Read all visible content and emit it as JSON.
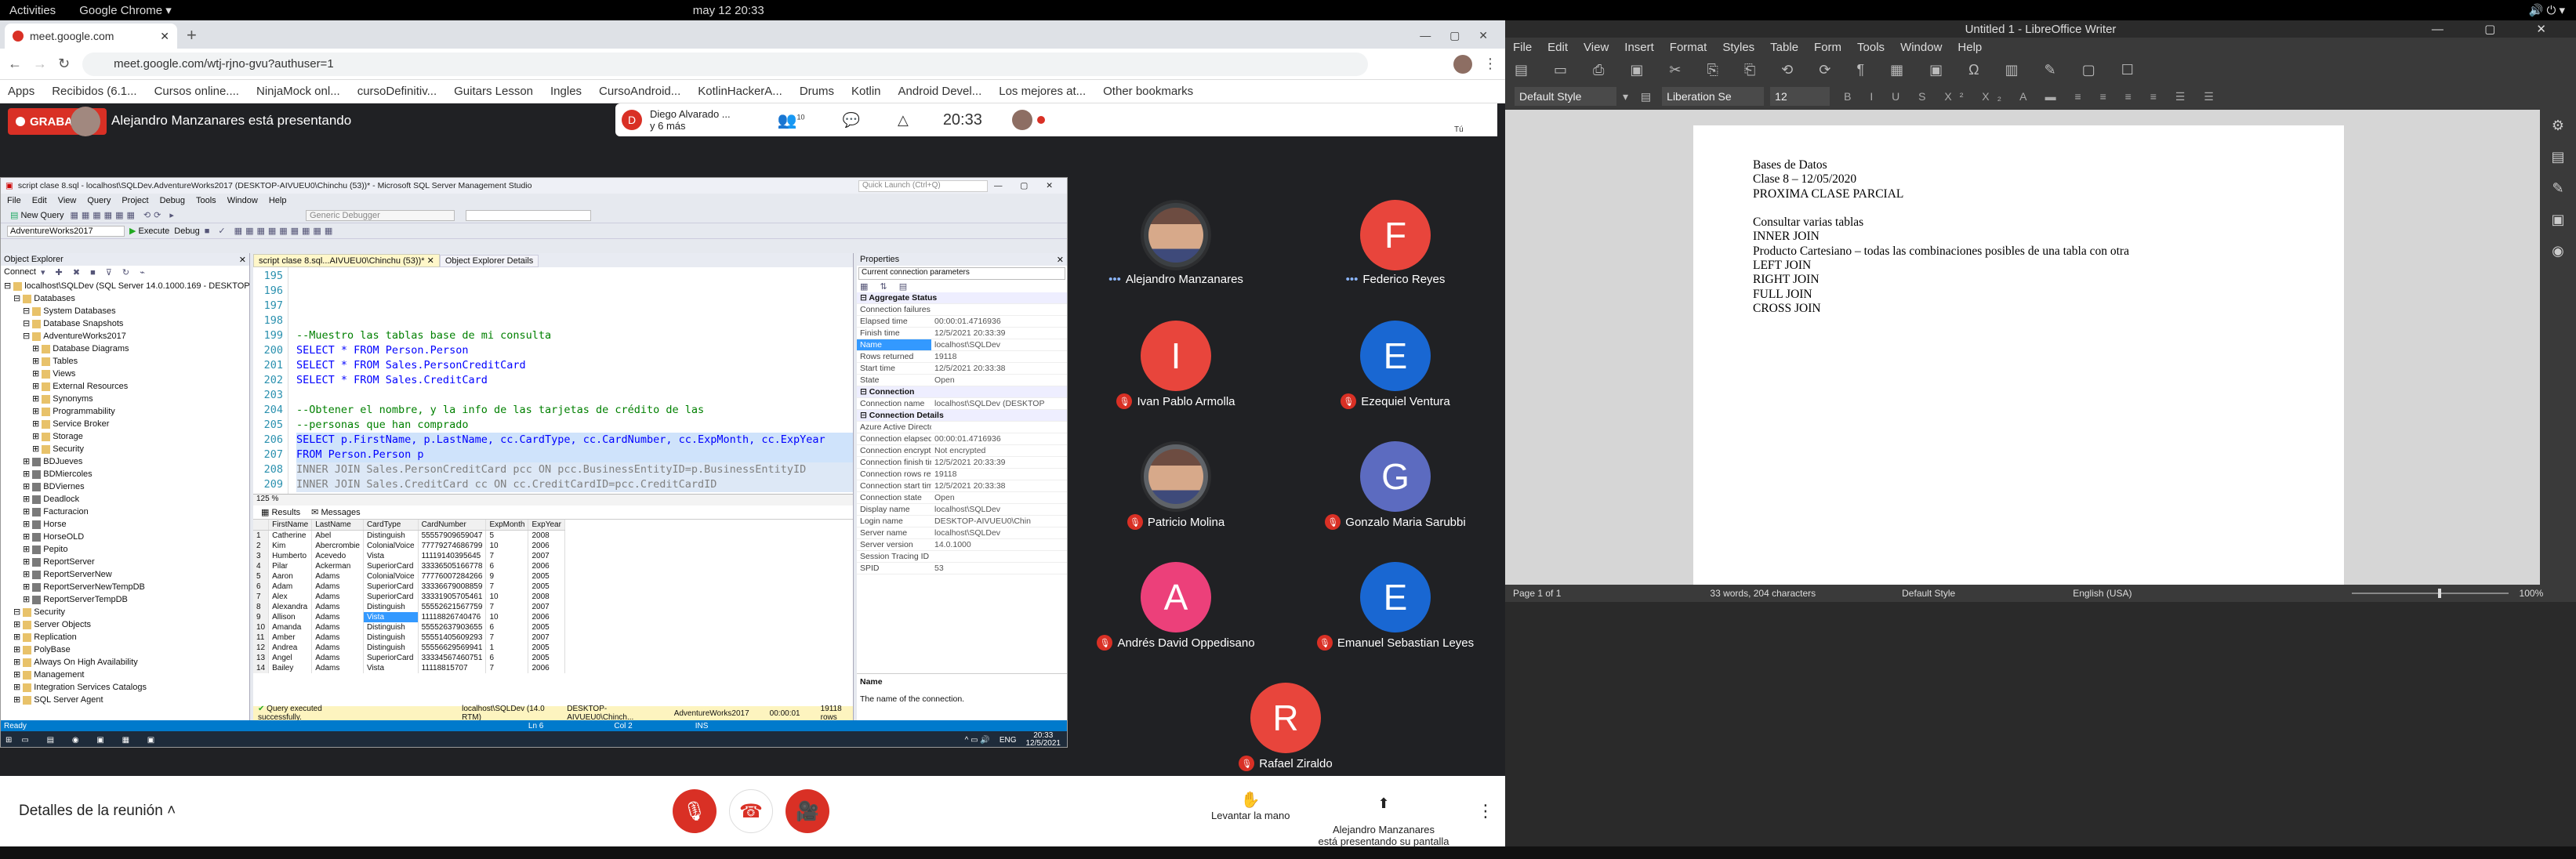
{
  "system": {
    "activities": "Activities",
    "app": "Google Chrome",
    "clock": "may 12  20:33"
  },
  "chrome": {
    "tab_title": "meet.google.com",
    "url": "meet.google.com/wtj-rjno-gvu?authuser=1",
    "bookmarks": [
      "Apps",
      "Recibidos (6.1...",
      "Cursos online....",
      "NinjaMock onl...",
      "cursoDefinitiv...",
      "Guitars Lesson",
      "Ingles",
      "CursoAndroid...",
      "KotlinHackerA...",
      "Drums",
      "Kotlin",
      "Android Devel...",
      "Los mejores at...",
      "Other bookmarks"
    ]
  },
  "meet": {
    "recording": "GRABANDO",
    "presenter": "Alejandro Manzanares está presentando",
    "pinned_user": "Diego Alvarado ...",
    "pinned_more": "y 6 más",
    "participants_count": "10",
    "time": "20:33",
    "you_label": "Tú",
    "participants": [
      {
        "name": "Alejandro Manzanares",
        "initial": "",
        "color": "#3c4043",
        "muted": false
      },
      {
        "name": "Federico Reyes",
        "initial": "F",
        "color": "#e8453c",
        "muted": false
      },
      {
        "name": "Ivan Pablo Armolla",
        "initial": "I",
        "color": "#e8453c",
        "muted": true
      },
      {
        "name": "Ezequiel Ventura",
        "initial": "E",
        "color": "#1967d2",
        "muted": true
      },
      {
        "name": "Patricio Molina",
        "initial": "",
        "color": "#5f6368",
        "muted": true
      },
      {
        "name": "Gonzalo Maria Sarubbi",
        "initial": "G",
        "color": "#5c6bc0",
        "muted": true
      },
      {
        "name": "Andrés David Oppedisano",
        "initial": "A",
        "color": "#ec407a",
        "muted": true
      },
      {
        "name": "Emanuel Sebastian Leyes",
        "initial": "E",
        "color": "#1967d2",
        "muted": true
      },
      {
        "name": "Rafael Ziraldo",
        "initial": "R",
        "color": "#e8453c",
        "muted": true
      }
    ],
    "meeting_details": "Detalles de la reunión",
    "raise_hand": "Levantar la mano",
    "presenting": "Alejandro Manzanares\nestá presentando su pantalla"
  },
  "ssms": {
    "title": "script clase 8.sql - localhost\\SQLDev.AdventureWorks2017 (DESKTOP-AIVUEU0\\Chinchu (53))* - Microsoft SQL Server Management Studio",
    "quick_launch": "Quick Launch (Ctrl+Q)",
    "menu": [
      "File",
      "Edit",
      "View",
      "Query",
      "Project",
      "Debug",
      "Tools",
      "Window",
      "Help"
    ],
    "toolbar_new_query": "New Query",
    "execute": "Execute",
    "debug": "Debug",
    "db_selector": "AdventureWorks2017",
    "debugger_selector": "Generic Debugger",
    "object_explorer_title": "Object Explorer",
    "connect": "Connect",
    "tree": [
      "localhost\\SQLDev (SQL Server 14.0.1000.169 - DESKTOP",
      "Databases",
      "System Databases",
      "Database Snapshots",
      "AdventureWorks2017",
      "Database Diagrams",
      "Tables",
      "Views",
      "External Resources",
      "Synonyms",
      "Programmability",
      "Service Broker",
      "Storage",
      "Security",
      "BDJueves",
      "BDMiercoles",
      "BDViernes",
      "Deadlock",
      "Facturacion",
      "Horse",
      "HorseOLD",
      "Pepito",
      "ReportServer",
      "ReportServerNew",
      "ReportServerNewTempDB",
      "ReportServerTempDB",
      "Security",
      "Server Objects",
      "Replication",
      "PolyBase",
      "Always On High Availability",
      "Management",
      "Integration Services Catalogs",
      "SQL Server Agent"
    ],
    "editor_tab": "script clase 8.sql...AIVUEU0\\Chinchu (53))*",
    "oe_details_tab": "Object Explorer Details",
    "line_numbers": [
      "195",
      "196",
      "197",
      "198",
      "199",
      "200",
      "201",
      "202",
      "203",
      "204",
      "205",
      "206",
      "207",
      "208",
      "209"
    ],
    "code_comment1": "--Muestro las tablas base de mi consulta",
    "code_select1": "SELECT * FROM Person.Person",
    "code_select2": "SELECT * FROM Sales.PersonCreditCard",
    "code_select3": "SELECT * FROM Sales.CreditCard",
    "code_comment2": "--Obtener el nombre, y la info de las tarjetas de crédito de las",
    "code_comment3": "--personas que han comprado",
    "code_select4": "SELECT p.FirstName, p.LastName, cc.CardType, cc.CardNumber, cc.ExpMonth, cc.ExpYear",
    "code_from": "FROM Person.Person p",
    "code_join1": "INNER JOIN Sales.PersonCreditCard pcc ON pcc.BusinessEntityID=p.BusinessEntityID",
    "code_join2": "INNER JOIN Sales.CreditCard cc ON cc.CreditCardID=pcc.CreditCardID",
    "zoom": "125 %",
    "results_tab": "Results",
    "messages_tab": "Messages",
    "columns": [
      "",
      "FirstName",
      "LastName",
      "CardType",
      "CardNumber",
      "ExpMonth",
      "ExpYear"
    ],
    "rows": [
      [
        "1",
        "Catherine",
        "Abel",
        "Distinguish",
        "55557909659047",
        "5",
        "2008"
      ],
      [
        "2",
        "Kim",
        "Abercrombie",
        "ColonialVoice",
        "77779274686799",
        "10",
        "2006"
      ],
      [
        "3",
        "Humberto",
        "Acevedo",
        "Vista",
        "11119140395645",
        "7",
        "2007"
      ],
      [
        "4",
        "Pilar",
        "Ackerman",
        "SuperiorCard",
        "33336505166778",
        "6",
        "2006"
      ],
      [
        "5",
        "Aaron",
        "Adams",
        "ColonialVoice",
        "77776007284266",
        "9",
        "2005"
      ],
      [
        "6",
        "Adam",
        "Adams",
        "SuperiorCard",
        "33336679008859",
        "7",
        "2005"
      ],
      [
        "7",
        "Alex",
        "Adams",
        "SuperiorCard",
        "33331905705461",
        "10",
        "2008"
      ],
      [
        "8",
        "Alexandra",
        "Adams",
        "Distinguish",
        "55552621567759",
        "7",
        "2007"
      ],
      [
        "9",
        "Allison",
        "Adams",
        "Vista",
        "11118826740476",
        "10",
        "2006"
      ],
      [
        "10",
        "Amanda",
        "Adams",
        "Distinguish",
        "55552637903655",
        "6",
        "2005"
      ],
      [
        "11",
        "Amber",
        "Adams",
        "Distinguish",
        "55551405609293",
        "7",
        "2007"
      ],
      [
        "12",
        "Andrea",
        "Adams",
        "Distinguish",
        "55556629569941",
        "1",
        "2005"
      ],
      [
        "13",
        "Angel",
        "Adams",
        "SuperiorCard",
        "33334567460751",
        "6",
        "2005"
      ],
      [
        "14",
        "Bailey",
        "Adams",
        "Vista",
        "11118815707",
        "7",
        "2006"
      ]
    ],
    "status_query": "Query executed successfully.",
    "status_server": "localhost\\SQLDev (14.0 RTM)",
    "status_user": "DESKTOP-AIVUEU0\\Chinch...",
    "status_db": "AdventureWorks2017",
    "status_time": "00:00:01",
    "status_rows": "19118 rows",
    "status_ready": "Ready",
    "status_ln": "Ln 6",
    "status_col": "Col 2",
    "status_ins": "INS",
    "properties_title": "Properties",
    "properties_selector": "Current connection parameters",
    "prop_groups": [
      {
        "name": "Aggregate Status",
        "items": [
          [
            "Connection failures",
            ""
          ],
          [
            "Elapsed time",
            "00:00:01.4716936"
          ],
          [
            "Finish time",
            "12/5/2021 20:33:39"
          ],
          [
            "Name",
            "localhost\\SQLDev"
          ],
          [
            "Rows returned",
            "19118"
          ],
          [
            "Start time",
            "12/5/2021 20:33:38"
          ],
          [
            "State",
            "Open"
          ]
        ]
      },
      {
        "name": "Connection",
        "items": [
          [
            "Connection name",
            "localhost\\SQLDev (DESKTOP"
          ]
        ]
      },
      {
        "name": "Connection Details",
        "items": [
          [
            "Azure Active Director",
            ""
          ],
          [
            "Connection elapsed ti",
            "00:00:01.4716936"
          ],
          [
            "Connection encryptio",
            "Not encrypted"
          ],
          [
            "Connection finish tim",
            "12/5/2021 20:33:39"
          ],
          [
            "Connection rows retu",
            "19118"
          ],
          [
            "Connection start tim",
            "12/5/2021 20:33:38"
          ],
          [
            "Connection state",
            "Open"
          ],
          [
            "Display name",
            "localhost\\SQLDev"
          ],
          [
            "Login name",
            "DESKTOP-AIVUEU0\\Chin"
          ],
          [
            "Server name",
            "localhost\\SQLDev"
          ],
          [
            "Server version",
            "14.0.1000"
          ],
          [
            "Session Tracing ID",
            ""
          ],
          [
            "SPID",
            "53"
          ]
        ]
      }
    ],
    "prop_desc_title": "Name",
    "prop_desc_text": "The name of the connection.",
    "taskbar_lang": "ENG",
    "taskbar_time": "20:33",
    "taskbar_date": "12/5/2021"
  },
  "writer": {
    "title": "Untitled 1 - LibreOffice Writer",
    "menu": [
      "File",
      "Edit",
      "View",
      "Insert",
      "Format",
      "Styles",
      "Table",
      "Form",
      "Tools",
      "Window",
      "Help"
    ],
    "style": "Default Style",
    "font": "Liberation Se",
    "size": "12",
    "doc_lines": [
      "Bases de Datos",
      "Clase 8 – 12/05/2020",
      "PROXIMA CLASE PARCIAL",
      "",
      "Consultar varias tablas",
      "INNER JOIN",
      "Producto Cartesiano – todas las combinaciones posibles de una tabla con otra",
      "LEFT JOIN",
      "RIGHT JOIN",
      "FULL JOIN",
      "CROSS JOIN"
    ],
    "status_page": "Page 1 of 1",
    "status_words": "33 words, 204 characters",
    "status_style": "Default Style",
    "status_lang": "English (USA)",
    "status_zoom": "100%"
  }
}
